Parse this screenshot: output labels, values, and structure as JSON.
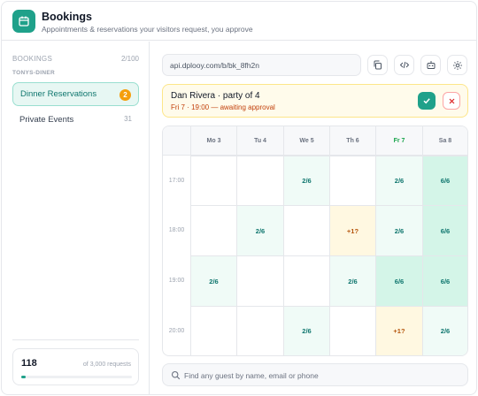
{
  "app": {
    "title": "Bookings",
    "subtitle": "Appointments & reservations your visitors request, you approve",
    "accent": "#1fa18a"
  },
  "sidebar": {
    "heading": "BOOKINGS",
    "count": "2/100",
    "org": "TONYS-DINER",
    "items": [
      {
        "label": "Dinner Reservations",
        "badge": "2",
        "active": true
      },
      {
        "label": "Private Events",
        "count": "31",
        "active": false
      }
    ],
    "usage": {
      "value": "118",
      "of": "of 3,000 requests",
      "fraction": 0.039
    }
  },
  "toolbar": {
    "url": "api.dplooy.com/b/bk_8fh2n",
    "buttons": [
      "copy-icon",
      "code-icon",
      "robot-icon",
      "settings-icon"
    ]
  },
  "pending": {
    "name": "Dan Rivera · party of 4",
    "when": "Fri 7 · 19:00 — awaiting approval"
  },
  "calendar": {
    "days": [
      "Mo 3",
      "Tu 4",
      "We 5",
      "Th 6",
      "Fr 7",
      "Sa 8"
    ],
    "today": "Fr 7",
    "times": [
      "17:00",
      "18:00",
      "19:00",
      "20:00"
    ],
    "slots": [
      [
        {
          "t": "",
          "s": "empty"
        },
        {
          "t": "",
          "s": "empty"
        },
        {
          "t": "2/6",
          "s": "low"
        },
        {
          "t": "",
          "s": "empty"
        },
        {
          "t": "2/6",
          "s": "low"
        },
        {
          "t": "6/6",
          "s": "full"
        }
      ],
      [
        {
          "t": "",
          "s": "empty"
        },
        {
          "t": "2/6",
          "s": "low"
        },
        {
          "t": "",
          "s": "empty"
        },
        {
          "t": "+1?",
          "s": "pend"
        },
        {
          "t": "2/6",
          "s": "low"
        },
        {
          "t": "6/6",
          "s": "full"
        }
      ],
      [
        {
          "t": "2/6",
          "s": "low"
        },
        {
          "t": "",
          "s": "empty"
        },
        {
          "t": "",
          "s": "empty"
        },
        {
          "t": "2/6",
          "s": "low"
        },
        {
          "t": "6/6",
          "s": "full"
        },
        {
          "t": "6/6",
          "s": "full"
        }
      ],
      [
        {
          "t": "",
          "s": "empty"
        },
        {
          "t": "",
          "s": "empty"
        },
        {
          "t": "2/6",
          "s": "low"
        },
        {
          "t": "",
          "s": "empty"
        },
        {
          "t": "+1?",
          "s": "pend"
        },
        {
          "t": "2/6",
          "s": "low"
        }
      ]
    ]
  },
  "search": {
    "placeholder": "Find any guest by name, email or phone"
  }
}
